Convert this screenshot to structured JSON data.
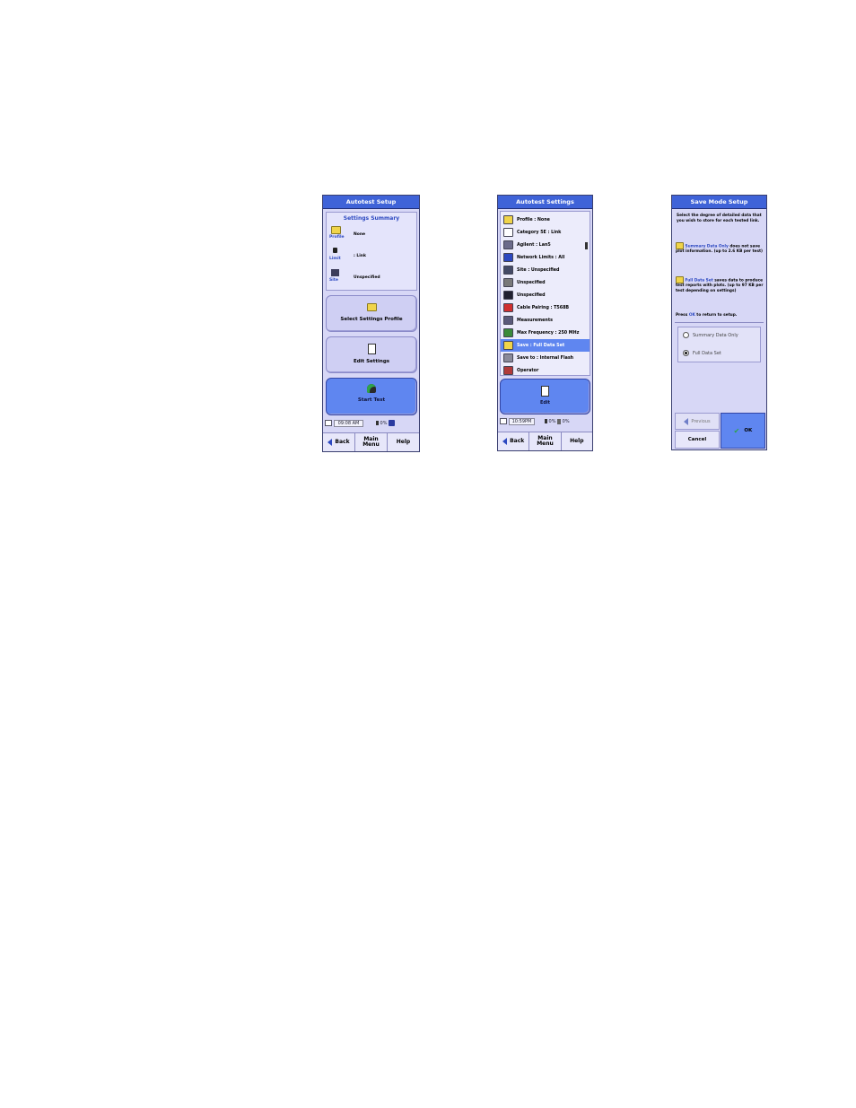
{
  "screen1": {
    "title": "Autotest Setup",
    "summary_heading": "Settings Summary",
    "summary_items": [
      {
        "icon": "profile-folder-icon",
        "label": "Profile",
        "value": "None"
      },
      {
        "icon": "limit-lock-icon",
        "label": "Limit",
        "value": ": Link"
      },
      {
        "icon": "site-building-icon",
        "label": "Site",
        "value": "Unspecified"
      }
    ],
    "select_profile_label": "Select Settings Profile",
    "edit_settings_label": "Edit Settings",
    "start_test_label": "Start Test",
    "time": "09:08 AM",
    "battery": "0%",
    "nav": {
      "back": "Back",
      "main_menu": "Main Menu",
      "help": "Help"
    }
  },
  "screen2": {
    "title": "Autotest Settings",
    "items": [
      {
        "icon": "profile-icon",
        "label": "Profile : None",
        "color": "#f0d44a"
      },
      {
        "icon": "category-icon",
        "label": "Category 5E : Link",
        "color": "#ffffff"
      },
      {
        "icon": "agilent-icon",
        "label": "Agilent : Lan5",
        "color": "#6b6b8a"
      },
      {
        "icon": "network-icon",
        "label": "Network Limits : All",
        "color": "#2c48c0"
      },
      {
        "icon": "site-icon",
        "label": "Site : Unspecified",
        "color": "#444a66"
      },
      {
        "icon": "cable-icon",
        "label": "Unspecified",
        "color": "#7a7a7a"
      },
      {
        "icon": "connector-icon",
        "label": "Unspecified",
        "color": "#202030"
      },
      {
        "icon": "pairing-icon",
        "label": "Cable Pairing : T568B",
        "color": "#d03030"
      },
      {
        "icon": "measurement-icon",
        "label": "Measurements",
        "color": "#5a5a7a"
      },
      {
        "icon": "frequency-icon",
        "label": "Max Frequency : 250 MHz",
        "color": "#3a8a3a"
      },
      {
        "icon": "save-icon",
        "label": "Save : Full Data Set",
        "color": "#f0d44a"
      },
      {
        "icon": "save-to-icon",
        "label": "Save to : Internal Flash",
        "color": "#8a8a9a"
      },
      {
        "icon": "operator-icon",
        "label": "Operator",
        "color": "#b03a3a"
      }
    ],
    "selected_index": 10,
    "edit_label": "Edit",
    "time": "10:59PM",
    "battery": "0%",
    "memory": "0%",
    "nav": {
      "back": "Back",
      "main_menu": "Main Menu",
      "help": "Help"
    }
  },
  "screen3": {
    "title": "Save Mode Setup",
    "intro": "Select the degree of detailed data that you wish to store for each tested link.",
    "summary_term": "Summary Data Only",
    "summary_text": "does not save plot information. (up to 2.6 KB per test)",
    "full_term": "Full Data Set",
    "full_text": "saves data to produce test reports with plots. (up to 97 KB per test depending on settings)",
    "press_prefix": "Press",
    "press_ok": "OK",
    "press_suffix": "to return to setup.",
    "options": [
      "Summary Data Only",
      "Full Data Set"
    ],
    "selected_option": 1,
    "previous_label": "Previous",
    "cancel_label": "Cancel",
    "ok_label": "OK"
  }
}
